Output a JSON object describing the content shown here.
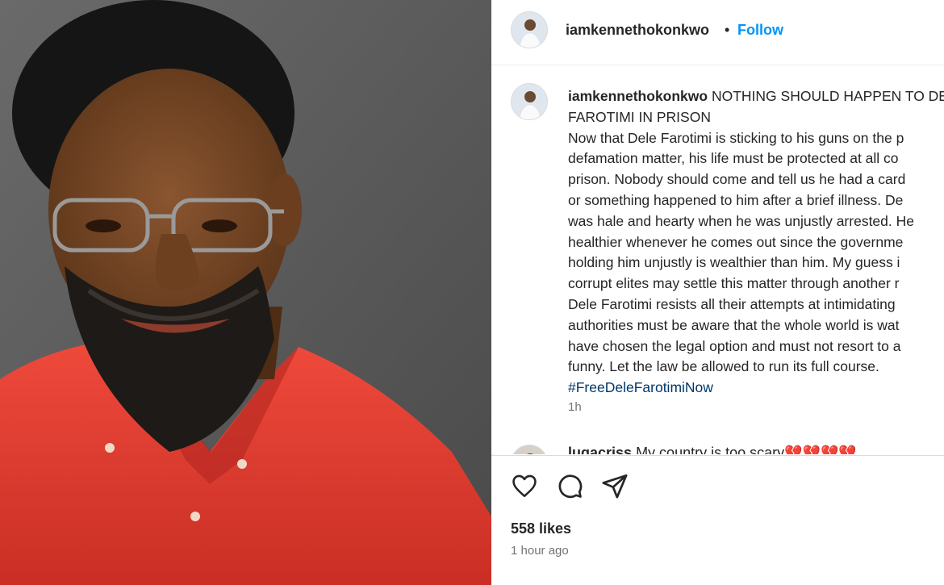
{
  "post": {
    "username": "iamkennethokonkwo",
    "separator": "•",
    "follow_label": "Follow",
    "caption_title": "NOTHING SHOULD HAPPEN TO DELE FAROTIMI IN PRISON",
    "caption_body": "Now that Dele Farotimi is sticking to his guns on the p\ndefamation matter, his life must be protected at all co\nprison. Nobody should come and tell us he had a card\nor something happened to him after a brief illness. De\nwas hale and hearty when he was unjustly arrested. He\nhealthier whenever he comes out since the governme\nholding him unjustly is wealthier than him. My guess i\ncorrupt elites may settle this matter through another r\nDele Farotimi resists all their attempts at intimidating\nauthorities must be aware that the whole world is wat\nhave chosen the legal option and must not resort to a\nfunny. Let the law be allowed to run its full course.",
    "hashtag": "#FreeDeleFarotimiNow",
    "caption_time": "1h",
    "likes": "558 likes",
    "posted_ago": "1 hour ago"
  },
  "comment": {
    "username": "lugacriss",
    "text": "My country is too scary",
    "emoji": "💔💔💔💔"
  },
  "icons": [
    "heart-icon",
    "comment-icon",
    "share-icon"
  ],
  "colors": {
    "follow": "#0095f6",
    "hashtag": "#00376b",
    "shirt": "#e23a2e",
    "muted": "#737373"
  }
}
